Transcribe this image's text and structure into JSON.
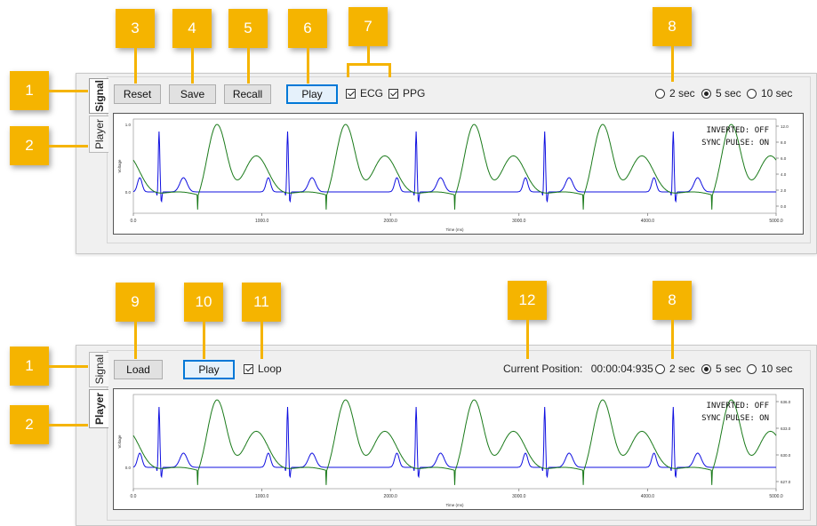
{
  "callouts": {
    "c1": "1",
    "c2": "2",
    "c3": "3",
    "c4": "4",
    "c5": "5",
    "c6": "6",
    "c7": "7",
    "c8": "8",
    "c9": "9",
    "c10": "10",
    "c11": "11",
    "c12": "12"
  },
  "signal_panel": {
    "tabs": {
      "signal": "Signal",
      "player": "Player"
    },
    "buttons": {
      "reset": "Reset",
      "save": "Save",
      "recall": "Recall",
      "play": "Play"
    },
    "checkboxes": {
      "ecg": "ECG",
      "ppg": "PPG"
    },
    "radios": {
      "r2": "2 sec",
      "r5": "5 sec",
      "r10": "10 sec",
      "selected": "5 sec"
    },
    "status": {
      "inverted": "INVERTED: OFF",
      "sync": "SYNC PULSE: ON"
    },
    "chart": {
      "ylabel": "Voltage",
      "xlabel": "Time (ms)",
      "left_ticks": [
        "1.0",
        "0.0"
      ],
      "right_ticks": [
        "12.0",
        "8.0",
        "6.0",
        "4.0",
        "2.0",
        "0.0"
      ],
      "x_ticks": [
        "0.0",
        "1000.0",
        "2000.0",
        "3000.0",
        "4000.0",
        "5000.0"
      ]
    }
  },
  "player_panel": {
    "tabs": {
      "signal": "Signal",
      "player": "Player"
    },
    "buttons": {
      "load": "Load",
      "play": "Play"
    },
    "checkboxes": {
      "loop": "Loop"
    },
    "position_label": "Current Position:",
    "position_value": "00:00:04:935",
    "radios": {
      "r2": "2 sec",
      "r5": "5 sec",
      "r10": "10 sec",
      "selected": "5 sec"
    },
    "status": {
      "inverted": "INVERTED: OFF",
      "sync": "SYNC PULSE: ON"
    },
    "chart": {
      "ylabel": "Voltage",
      "xlabel": "Time (ms)",
      "left_ticks": [
        "0.0"
      ],
      "right_ticks": [
        "636.0",
        "633.0",
        "630.0",
        "627.0"
      ],
      "x_ticks": [
        "0.0",
        "1000.0",
        "2000.0",
        "3000.0",
        "4000.0",
        "5000.0"
      ]
    }
  },
  "chart_data": [
    {
      "type": "line",
      "xlabel": "Time (ms)",
      "ylabel": "Voltage",
      "xlim": [
        0,
        5000
      ],
      "series": [
        {
          "color": "#1010e0",
          "beat_times_ms": [
            200,
            1200,
            2200,
            3200,
            4200
          ]
        },
        {
          "color": "#1a7a1a",
          "peak_times_ms": [
            650,
            1650,
            2650,
            3650,
            4650
          ]
        }
      ]
    },
    {
      "type": "line",
      "xlabel": "Time (ms)",
      "ylabel": "Voltage",
      "xlim": [
        0,
        5000
      ],
      "series": [
        {
          "color": "#1010e0",
          "beat_times_ms": [
            200,
            1200,
            2200,
            3200,
            4200
          ]
        },
        {
          "color": "#1a7a1a",
          "peak_times_ms": [
            650,
            1650,
            2650,
            3650,
            4650
          ]
        }
      ]
    }
  ]
}
